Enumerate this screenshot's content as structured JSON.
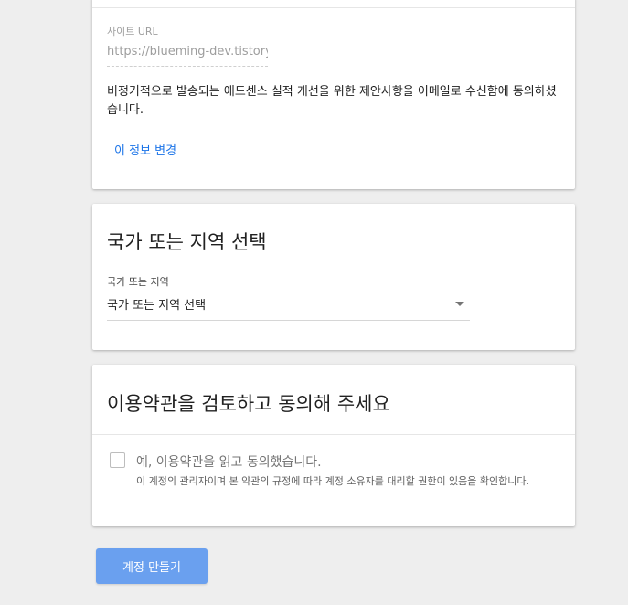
{
  "account_info": {
    "site_url_label": "사이트 URL",
    "site_url_value": "https://blueming-dev.tistory.com",
    "email_consent_text": "비정기적으로 발송되는 애드센스 실적 개선을 위한 제안사항을 이메일로 수신함에 동의하셨습니다.",
    "change_info_link": "이 정보 변경"
  },
  "region": {
    "title": "국가 또는 지역 선택",
    "field_label": "국가 또는 지역",
    "selected_value": "국가 또는 지역 선택"
  },
  "terms": {
    "title": "이용약관을 검토하고 동의해 주세요",
    "checkbox_label": "예, 이용약관을 읽고 동의했습니다.",
    "note": "이 계정의 관리자이며 본 약관의 규정에 따라 계정 소유자를 대리할 권한이 있음을 확인합니다.",
    "checked": false
  },
  "actions": {
    "create_account_label": "계정 만들기"
  },
  "colors": {
    "link": "#1a73e8",
    "primary_button": "#6aa0ef",
    "background": "#eeeeee"
  }
}
